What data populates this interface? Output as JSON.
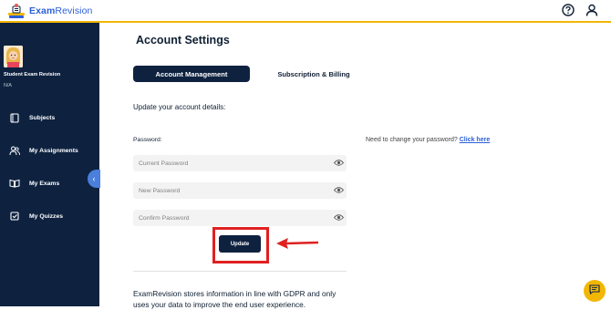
{
  "app": {
    "name_prefix": "Exam",
    "name_suffix": "Revision"
  },
  "header": {
    "help_icon": "question-circle-icon",
    "profile_icon": "user-icon"
  },
  "sidebar": {
    "student_name": "Student Exam Revision",
    "student_sub": "N/A",
    "items": [
      {
        "label": "Subjects",
        "icon": "book-icon"
      },
      {
        "label": "My Assignments",
        "icon": "users-icon"
      },
      {
        "label": "My Exams",
        "icon": "open-book-icon"
      },
      {
        "label": "My Quizzes",
        "icon": "checkbox-icon"
      }
    ],
    "collapse_glyph": "‹"
  },
  "main": {
    "title": "Account Settings",
    "tabs": [
      {
        "label": "Account Management",
        "active": true
      },
      {
        "label": "Subscription & Billing",
        "active": false
      }
    ],
    "section_label": "Update your account details:",
    "password_label": "Password:",
    "fields": [
      {
        "placeholder": "Current Password",
        "value": ""
      },
      {
        "placeholder": "New Password",
        "value": ""
      },
      {
        "placeholder": "Confirm Password",
        "value": ""
      }
    ],
    "help_text": "Need to change your password?",
    "help_link": "Click here",
    "update_label": "Update",
    "gdpr_text": "ExamRevision stores information in line with GDPR and only uses your data to improve the end user experience."
  },
  "colors": {
    "navy": "#0e2240",
    "accent_blue": "#2b5fd9",
    "yellow": "#f2b705",
    "annotation_red": "#e02020"
  }
}
